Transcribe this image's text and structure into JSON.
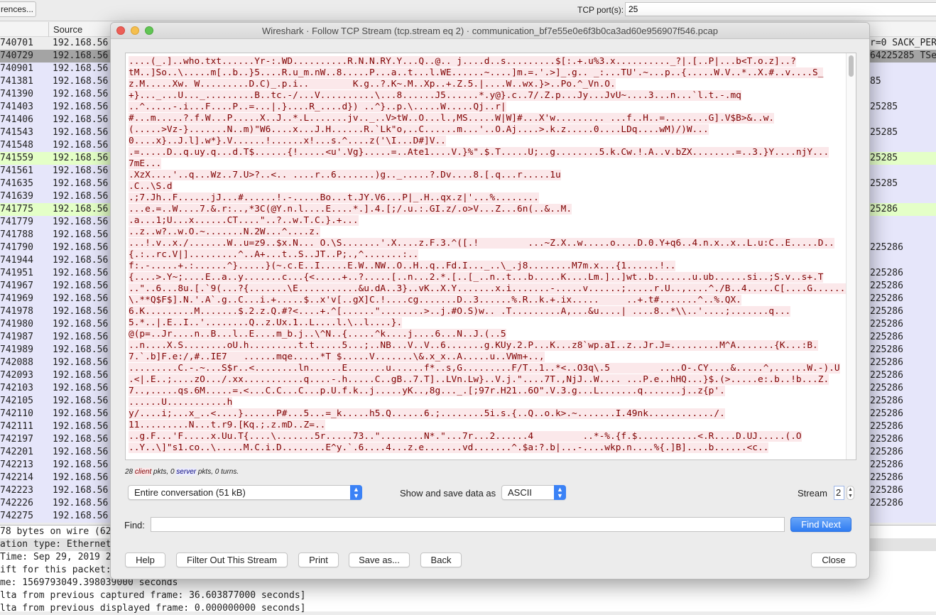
{
  "toolbar": {
    "preferences_label": "rences...",
    "tcp_ports_label": "TCP port(s):",
    "tcp_ports_value": "25"
  },
  "packet_list": {
    "source_header": "Source",
    "rows": [
      {
        "no": "740701",
        "src": "192.168.56",
        "info": "r=0 SACK_PER",
        "style": "sel0"
      },
      {
        "no": "740729",
        "src": "192.168.56",
        "info": "64225285 TSe",
        "style": "sel1"
      },
      {
        "no": "740901",
        "src": "192.168.56",
        "info": "",
        "style": ""
      },
      {
        "no": "741381",
        "src": "192.168.56",
        "info": "85",
        "style": ""
      },
      {
        "no": "741390",
        "src": "192.168.56",
        "info": "",
        "style": ""
      },
      {
        "no": "741403",
        "src": "192.168.56",
        "info": "25285",
        "style": ""
      },
      {
        "no": "741406",
        "src": "192.168.56",
        "info": "",
        "style": ""
      },
      {
        "no": "741543",
        "src": "192.168.56",
        "info": "25285",
        "style": ""
      },
      {
        "no": "741548",
        "src": "192.168.56",
        "info": "",
        "style": ""
      },
      {
        "no": "741559",
        "src": "192.168.56",
        "info": "25285",
        "style": "green"
      },
      {
        "no": "741561",
        "src": "192.168.56",
        "info": "",
        "style": ""
      },
      {
        "no": "741635",
        "src": "192.168.56",
        "info": "25285",
        "style": ""
      },
      {
        "no": "741639",
        "src": "192.168.56",
        "info": "",
        "style": ""
      },
      {
        "no": "741775",
        "src": "192.168.56",
        "info": "25286",
        "style": "green"
      },
      {
        "no": "741779",
        "src": "192.168.56",
        "info": "",
        "style": ""
      },
      {
        "no": "741788",
        "src": "192.168.56",
        "info": "",
        "style": ""
      },
      {
        "no": "741790",
        "src": "192.168.56",
        "info": "225286",
        "style": ""
      },
      {
        "no": "741944",
        "src": "192.168.56",
        "info": "",
        "style": ""
      },
      {
        "no": "741951",
        "src": "192.168.56",
        "info": "225286",
        "style": ""
      },
      {
        "no": "741967",
        "src": "192.168.56",
        "info": "225286",
        "style": ""
      },
      {
        "no": "741969",
        "src": "192.168.56",
        "info": "225286",
        "style": ""
      },
      {
        "no": "741978",
        "src": "192.168.56",
        "info": "225286",
        "style": ""
      },
      {
        "no": "741980",
        "src": "192.168.56",
        "info": "225286",
        "style": ""
      },
      {
        "no": "741987",
        "src": "192.168.56",
        "info": "225286",
        "style": ""
      },
      {
        "no": "741989",
        "src": "192.168.56",
        "info": "225286",
        "style": ""
      },
      {
        "no": "742088",
        "src": "192.168.56",
        "info": "225286",
        "style": ""
      },
      {
        "no": "742093",
        "src": "192.168.56",
        "info": "225286",
        "style": ""
      },
      {
        "no": "742103",
        "src": "192.168.56",
        "info": "225286",
        "style": ""
      },
      {
        "no": "742105",
        "src": "192.168.56",
        "info": "225286",
        "style": ""
      },
      {
        "no": "742110",
        "src": "192.168.56",
        "info": "225286",
        "style": ""
      },
      {
        "no": "742111",
        "src": "192.168.56",
        "info": "225286",
        "style": ""
      },
      {
        "no": "742197",
        "src": "192.168.56",
        "info": "225286",
        "style": ""
      },
      {
        "no": "742201",
        "src": "192.168.56",
        "info": "225286",
        "style": ""
      },
      {
        "no": "742213",
        "src": "192.168.56",
        "info": "225286",
        "style": ""
      },
      {
        "no": "742214",
        "src": "192.168.56",
        "info": "225286",
        "style": ""
      },
      {
        "no": "742223",
        "src": "192.168.56",
        "info": "225286",
        "style": ""
      },
      {
        "no": "742226",
        "src": "192.168.56",
        "info": "225286",
        "style": ""
      },
      {
        "no": "742275",
        "src": "192.168.56",
        "info": "",
        "style": ""
      }
    ]
  },
  "details": [
    {
      "text": "78 bytes on wire (62",
      "gray": false
    },
    {
      "text": "ation type: Ethernet",
      "gray": true
    },
    {
      "text": "Time: Sep 29, 2019 2",
      "gray": false
    },
    {
      "text": "ift for this packet:",
      "gray": false
    },
    {
      "text": "me: 1569793049.398039000 seconds",
      "gray": false
    },
    {
      "text": "lta from previous captured frame: 36.603877000 seconds]",
      "gray": false
    },
    {
      "text": "lta from previous displayed frame: 0.000000000 seconds]",
      "gray": false
    }
  ],
  "dialog": {
    "title": "Wireshark · Follow TCP Stream (tcp.stream eq 2) · communication_bf7e55e0e6f3b0ca3ad60e956907f546.pcap",
    "colors": {
      "client_text": "#7f0000",
      "client_bg": "#fbe8ea",
      "server_text": "#00007f",
      "accent": "#3b82f6"
    },
    "stream_lines": [
      "....(_.]..who.txt......Yr-:.WD..........R.N.N.RY.Y...Q..@.. j....d..s.........$[:.+.u%3.x.........._?|.[..P|...b<T.o.z]..?",
      "tM..]So..\\.....m[..b..}5....R.u_m.nW..8.....P...a..t...l.WE......~....]m.=.'.>]_.g.. _:...TU'.~...p..{.....W.V..*..X.#..v....S_",
      "z.M.....Xw. W.........D.C)_.p.i..        K.g..?.K~.M..Xp..+.Z.5.|....W..wx.}>..Po.^_Vn.O.",
      "+}..._...U..._.........B..tc.-/...V..........\\...8......J5......*.y@}.c..7/.Z.p...Jy...JvU~....3...n...`l.t.-.mq",
      "..^.....-.i...F....P..=...|.}....R_....d}) ..^}..p.\\.....W.....Qj..r|",
      "#...m.....?.f.W...P.....X..J..*.L.......jv.._..V>tW..O...l.,MS.....W|W]#...X'w......... ...f..H..=........G].V$B>&..w.",
      "(.....>Vz-}.......N..m)\"W6....x...J.H......R.`Lk\"o,..C......m...'..O.Aj....>.k.z.....0....LDq....wM)/)W...",
      "0....x}..J.l].w*}.V......!......x!...s.^....z('\\I...D#]V..",
      ".=.....D..q.uy.q...d.T$......{!.....<u'.Vg}.....=..Ate1....V.}%\".$.T.....U;..g........5.k.Cw.!.A..v.bZX........=..3.}Y....njY...",
      "7mE...",
      ".XzX....'..q...Wz..7.U>?..<.. ....r..6.......)g.._.....?.Dv....8.[.q...r.....1u",
      ".C..\\S.d",
      ".;7.Jh..F......jJ...#......!.-.....Bo...t.JY.V6...P|_.H..qx.z|'...%........",
      "...e.=..W....7.&.r:..,*3C(@Y.n.l....E....*.].4.[;/.u.:.GI.z/.o>V...Z...6n(..&..M.",
      ".a...1;U...x......CT....\"..?..w.T.C.}.+...",
      "..z..w?..w.O.~.......N.2W...^....z.",
      "...!.v..x./.......W..u=z9..$x.N... O.\\S.......'.X....z.F.3.^([.!         ...~Z.X..w.....o....D.0.Y+q6..4.n.x..x..L.u:C..E.....D..",
      "{.:..rc.V|].........^..A+...t..S..JT..P;.,^.......:..",
      "f:.-.....+.:......^}.....}(~.c.E..I.....E.W..NW..O..H..q..Fd.I..._..\\_.j8........M7m.x...{1......!..",
      "{....>.Y~;....E..a..y.......c...{<.....+..?.....[..n...2.*.[..[_..n..t...b.....K....Lm.]..]wt..b.......u.ub......si..;S.v..s+.T",
      "..\"..6...8u.[.`9(...?{.......\\E...........&u.dA..3}..vK..X.Y.......x.i.......-.....v......;.....r.U..,....^./B..4.....C[....G.......",
      "\\.**Q$F$].N.'.A`.g..C...i.+.....$..x'v[..gX]C.!....cg.......D..3......%.R..k.+.ix.....     ..+.t#.......^..%.QX.",
      "6.K.........M.......$.2.z.Q.#?<....+.^[......\"........>..j.#O.S)w.. .T.........A,...&u....| ....8..*\\\\..'....;.......q...",
      "5.*..|.E..I..'........Q..z.Ux.1..L....l.\\..l....}.",
      "@(p=..Jr....n..B...l..E....m_b.j..\\^N..{.....^k....j....6...N..J.(..5",
      "..n....X.S........oU.h.........t.t.....5...;..NB...V..V..6.......g.KUy.2.P...K...z8`wp.aI..z..Jr.J=.........M^A.......{K...:B.",
      "7.`.b]F.e:/,#..IE7   ......mqe.....*T $.....V.......\\&.x_x..A.....u..VWm+..,",
      ".........C.-.~...S$r..<........ln......E.......u......f*..s,G.........F/T..1..*<..O3q\\.5         ....O-.CY....&.....^,......W.-).U",
      ".<|.E..;....zO.../.xx...........q....-.h.....C..gB..7.T]..LVn.Lw}..V.j.\"....7T.,NjJ..W.... ...P.e..hHQ...}$.(>.....e:.b..!b...Z.",
      "7..,.....qs.6M.....=.<...C.C...C...p.U.f.k..j.....yK..,8g..._.[;97r.H21..6O\".V.3.g...L.......q.......j..z{p'.",
      "......U...........h",
      "y/....i;...x_..<....}......P#...5...=_k.....h5.Q......6.;........5i.s.{..Q..o.k>.~.......I.49nk............/.",
      "11.........N...t.r9.[Kq.;.z.mD..Z=..",
      "..g.F...'F.....x.Uu.T{....\\.......5r.....73..\"........N*.\"...7r...2......4         ..*-%.{f.$...........<.R....D.UJ.....(.O",
      "..Y..\\]\"s1.co..\\.....M.C.i.D........E^y.`.6....4...z.e.......vd.......^.$a:?.b|...-....wkp.n....%{.]B]....b......<c.."
    ],
    "summary": {
      "count_client": "28",
      "client": "client",
      "mid": "pkts,",
      "count_server": "0",
      "server": "server",
      "end": "pkts, 0 turns."
    },
    "conversation_select": "Entire conversation (51 kB)",
    "show_label": "Show and save data as",
    "format_select": "ASCII",
    "stream_label": "Stream",
    "stream_value": "2",
    "find_label": "Find:",
    "find_value": "",
    "find_next": "Find Next",
    "buttons": {
      "help": "Help",
      "filter_out": "Filter Out This Stream",
      "print": "Print",
      "save_as": "Save as...",
      "back": "Back",
      "close": "Close"
    }
  }
}
